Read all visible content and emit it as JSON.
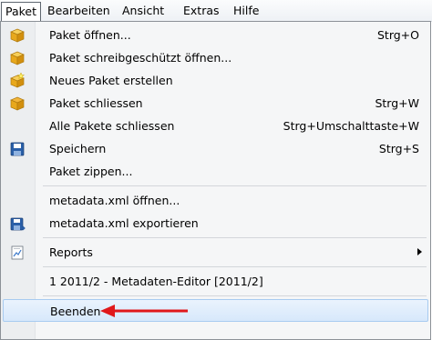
{
  "menubar": {
    "items": [
      "Paket",
      "Bearbeiten",
      "Ansicht",
      "Extras",
      "Hilfe"
    ]
  },
  "menu": {
    "items": [
      {
        "label": "Paket öffnen...",
        "shortcut": "Strg+O",
        "icon": "package-open-icon"
      },
      {
        "label": "Paket schreibgeschützt öffnen...",
        "shortcut": "",
        "icon": "package-readonly-icon"
      },
      {
        "label": "Neues Paket erstellen",
        "shortcut": "",
        "icon": "package-new-icon"
      },
      {
        "label": "Paket schliessen",
        "shortcut": "Strg+W",
        "icon": "package-close-icon"
      },
      {
        "label": "Alle Pakete schliessen",
        "shortcut": "Strg+Umschalttaste+W",
        "icon": ""
      },
      {
        "label": "Speichern",
        "shortcut": "Strg+S",
        "icon": "save-icon"
      },
      {
        "label": "Paket zippen...",
        "shortcut": "",
        "icon": ""
      },
      {
        "label": "metadata.xml öffnen...",
        "shortcut": "",
        "icon": ""
      },
      {
        "label": "metadata.xml exportieren",
        "shortcut": "",
        "icon": "export-icon"
      },
      {
        "label": "Reports",
        "shortcut": "",
        "icon": "report-icon"
      },
      {
        "label": "1 2011/2 - Metadaten-Editor  [2011/2]",
        "shortcut": "",
        "icon": ""
      },
      {
        "label": "Beenden",
        "shortcut": "",
        "icon": ""
      }
    ]
  },
  "colors": {
    "highlight_border": "#a8cbf0",
    "annotation_arrow": "#e0181b",
    "package_icon": "#e8a81c",
    "save_icon": "#2a5fa8"
  }
}
